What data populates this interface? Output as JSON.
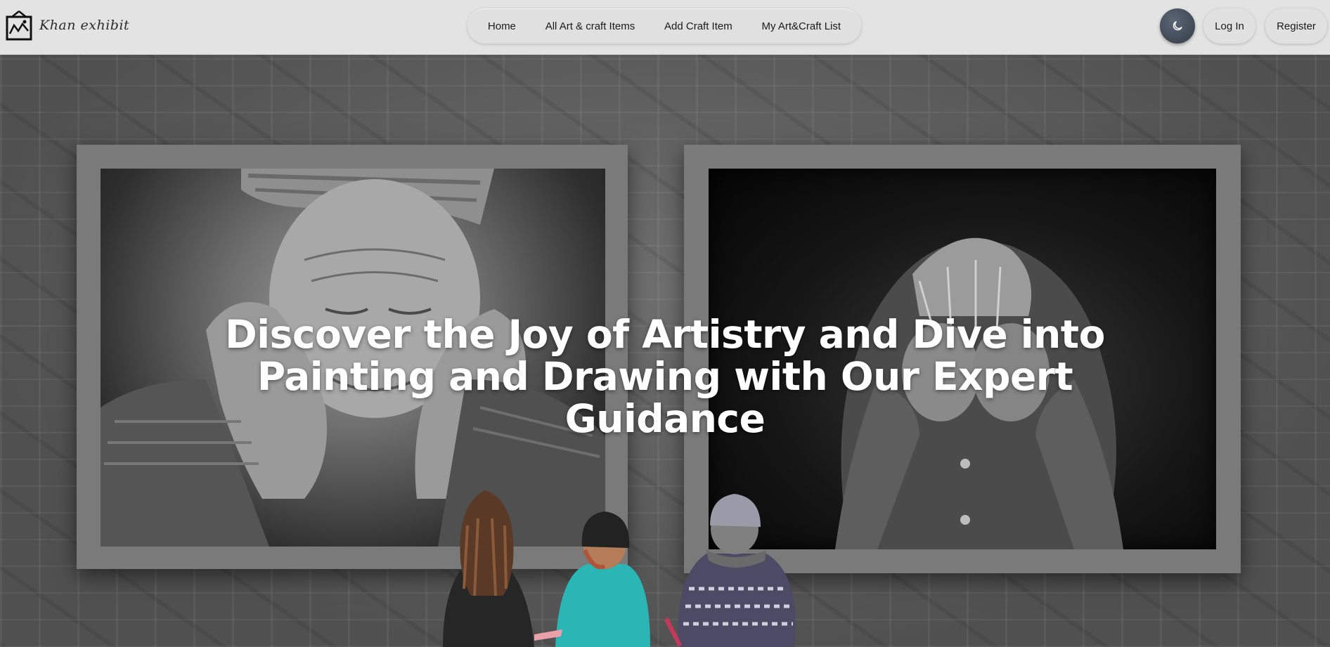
{
  "brand": {
    "name": "Khan exhibit",
    "icon": "framed-picture-icon"
  },
  "nav": {
    "links": [
      {
        "label": "Home"
      },
      {
        "label": "All Art & craft Items"
      },
      {
        "label": "Add Craft Item"
      },
      {
        "label": "My Art&Craft List"
      }
    ]
  },
  "actions": {
    "theme_icon": "moon-icon",
    "login_label": "Log In",
    "register_label": "Register"
  },
  "hero": {
    "title": "Discover the Joy of Artistry and Dive into Painting and Drawing with Our Expert Guidance"
  },
  "colors": {
    "navbar_bg": "#e3e3e3",
    "theme_button": "#3a4350",
    "frame": "#7a7a7a",
    "hero_text": "#ffffff"
  }
}
